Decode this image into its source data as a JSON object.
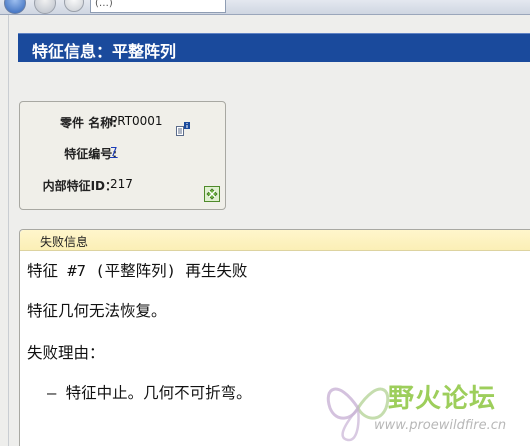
{
  "browser": {
    "address_text": "(…)"
  },
  "title": "特征信息：平整阵列",
  "properties": {
    "part_name_label": "零件 名称:",
    "part_name_value": "PRT0001",
    "feature_number_label": "特征编号:",
    "feature_number_value": "7",
    "internal_id_label": "内部特征ID：",
    "internal_id_value": "217"
  },
  "failure": {
    "header": "失败信息",
    "line1": "特征 #7 (平整阵列) 再生失败",
    "line2": "特征几何无法恢复。",
    "line3": "失败理由：",
    "line4": "– 特征中止。几何不可折弯。"
  },
  "watermark": {
    "cn": "野火论坛",
    "url": "www.proewildfire.cn"
  },
  "colors": {
    "title_bar": "#1a4a9c",
    "failure_header": "#fbefb6",
    "link": "#1a3bb8",
    "watermark_green": "#8cc63f"
  }
}
